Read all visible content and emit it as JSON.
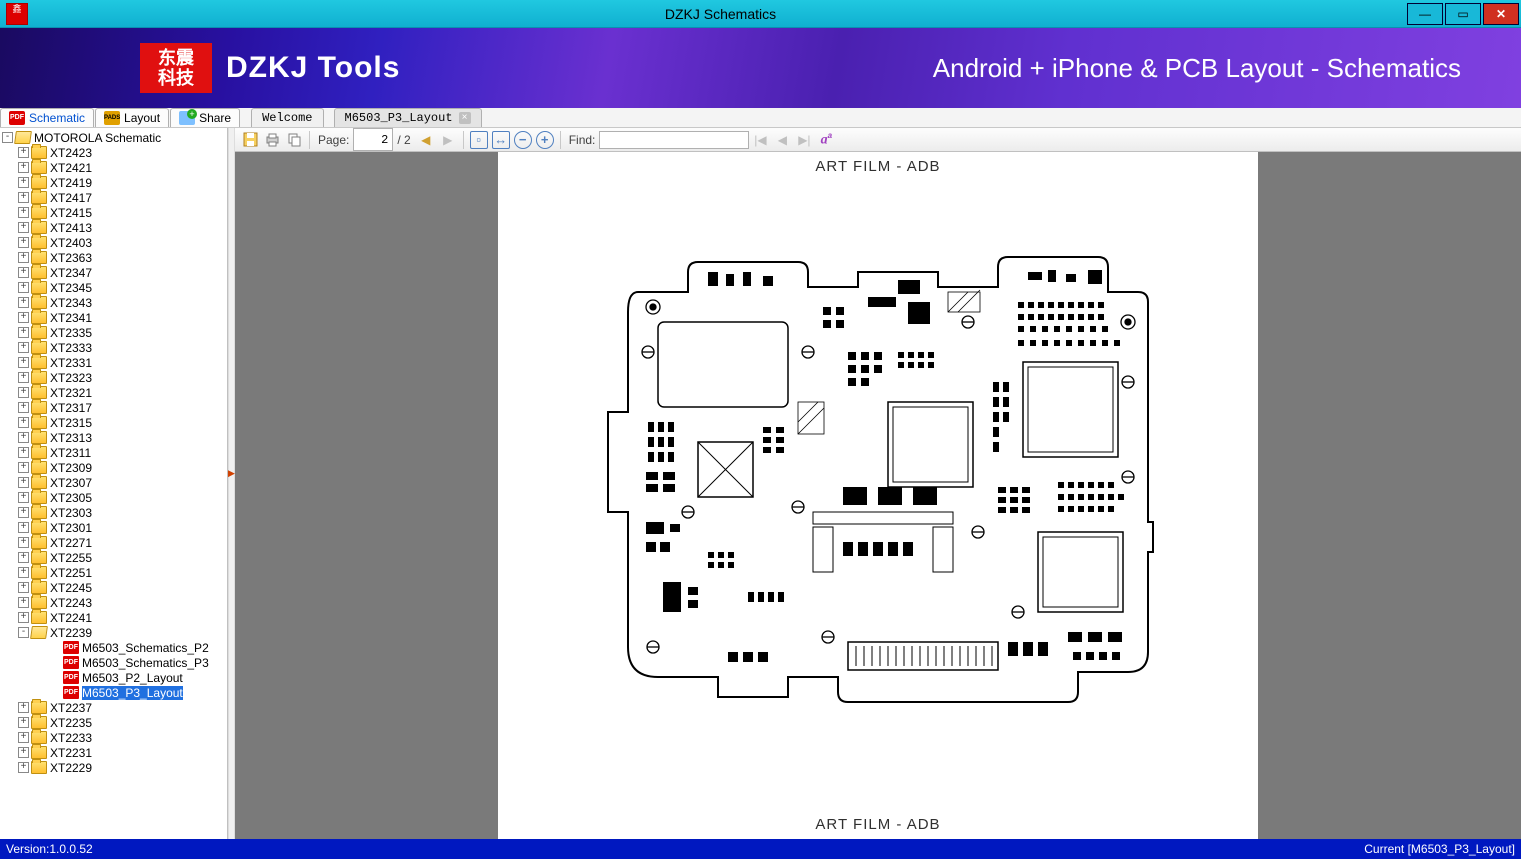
{
  "window": {
    "title": "DZKJ Schematics"
  },
  "banner": {
    "logo": "东震\n科技",
    "brand": "DZKJ Tools",
    "tagline": "Android + iPhone & PCB Layout - Schematics"
  },
  "outerTabs": {
    "schematic": "Schematic",
    "layout": "Layout",
    "share": "Share"
  },
  "docTabs": [
    {
      "label": "Welcome",
      "active": false,
      "closable": false
    },
    {
      "label": "M6503_P3_Layout",
      "active": true,
      "closable": true
    }
  ],
  "toolbar": {
    "pageLabel": "Page:",
    "pageCurrent": "2",
    "pageTotal": "/ 2",
    "findLabel": "Find:",
    "findValue": ""
  },
  "tree": {
    "root": "MOTOROLA Schematic",
    "folders": [
      "XT2423",
      "XT2421",
      "XT2419",
      "XT2417",
      "XT2415",
      "XT2413",
      "XT2403",
      "XT2363",
      "XT2347",
      "XT2345",
      "XT2343",
      "XT2341",
      "XT2335",
      "XT2333",
      "XT2331",
      "XT2323",
      "XT2321",
      "XT2317",
      "XT2315",
      "XT2313",
      "XT2311",
      "XT2309",
      "XT2307",
      "XT2305",
      "XT2303",
      "XT2301",
      "XT2271",
      "XT2255",
      "XT2251",
      "XT2245",
      "XT2243",
      "XT2241"
    ],
    "openFolder": "XT2239",
    "files": [
      "M6503_Schematics_P2",
      "M6503_Schematics_P3",
      "M6503_P2_Layout",
      "M6503_P3_Layout"
    ],
    "selectedFile": "M6503_P3_Layout",
    "tailFolders": [
      "XT2237",
      "XT2235",
      "XT2233",
      "XT2231",
      "XT2229"
    ]
  },
  "page": {
    "header": "ART FILM - ADB",
    "footer": "ART FILM - ADB"
  },
  "status": {
    "version": "Version:1.0.0.52",
    "current": "Current [M6503_P3_Layout]"
  }
}
